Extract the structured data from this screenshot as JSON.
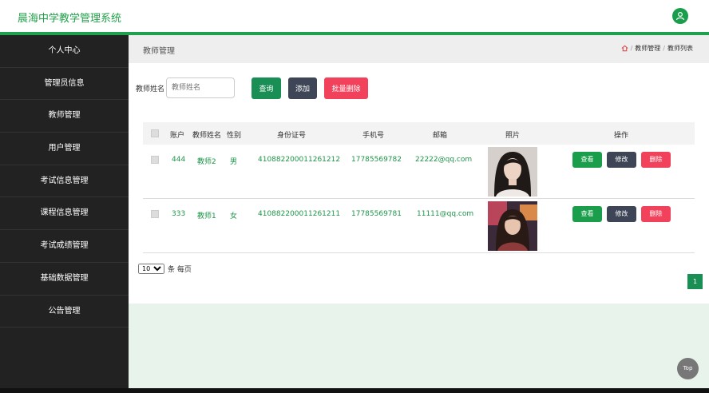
{
  "app": {
    "title": "晨海中学教学管理系统"
  },
  "sidebar": {
    "items": [
      {
        "label": "个人中心"
      },
      {
        "label": "管理员信息"
      },
      {
        "label": "教师管理"
      },
      {
        "label": "用户管理"
      },
      {
        "label": "考试信息管理"
      },
      {
        "label": "课程信息管理"
      },
      {
        "label": "考试成绩管理"
      },
      {
        "label": "基础数据管理"
      },
      {
        "label": "公告管理"
      }
    ]
  },
  "page": {
    "title": "教师管理",
    "breadcrumb": {
      "parent": "教师管理",
      "sep": "/",
      "current": "教师列表"
    }
  },
  "search": {
    "label": "教师姓名",
    "placeholder": "教师姓名",
    "value": "",
    "query_label": "查询",
    "add_label": "添加",
    "batch_delete_label": "批量删除"
  },
  "table": {
    "headers": [
      "账户",
      "教师姓名",
      "性别",
      "身份证号",
      "手机号",
      "邮箱",
      "照片",
      "操作"
    ],
    "rows": [
      {
        "account": "444",
        "name": "教师2",
        "gender": "男",
        "id_number": "410882200011261212",
        "phone": "17785569782",
        "email": "22222@qq.com"
      },
      {
        "account": "333",
        "name": "教师1",
        "gender": "女",
        "id_number": "410882200011261211",
        "phone": "17785569781",
        "email": "11111@qq.com"
      }
    ],
    "actions": {
      "view": "查看",
      "edit": "修改",
      "delete": "删除"
    }
  },
  "pagination": {
    "page_size": "10",
    "per_page_label": "条 每页",
    "current_page": "1"
  },
  "back_to_top": "Top",
  "colors": {
    "accent": "#1ea04c",
    "danger": "#f2425b",
    "dark": "#3d4556",
    "sidebar": "#222222"
  }
}
